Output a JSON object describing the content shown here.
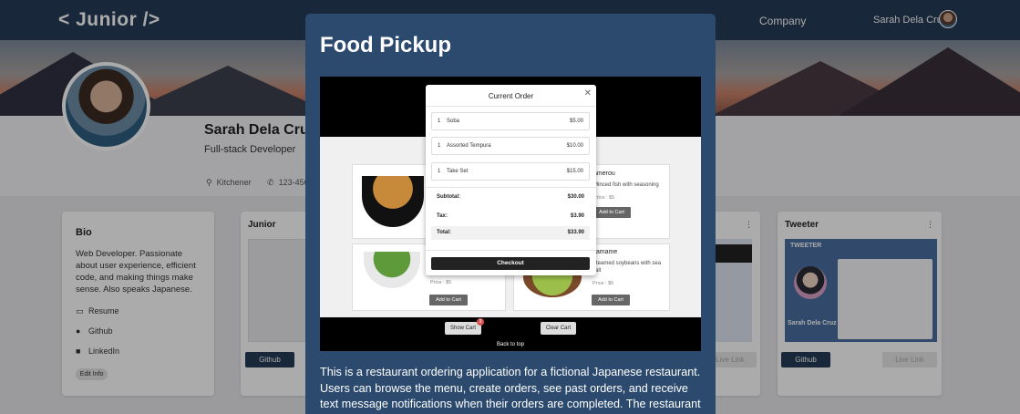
{
  "header": {
    "logo": "< Junior />",
    "nav_company": "Company",
    "user_name": "Sarah Dela Cruz"
  },
  "profile": {
    "name": "Sarah Dela Cruz",
    "title": "Full-stack Developer",
    "location": "Kitchener",
    "phone": "123-456"
  },
  "bio": {
    "heading": "Bio",
    "text": "Web Developer. Passionate about user experience, efficient code, and making things make sense. Also speaks Japanese.",
    "links": [
      "Resume",
      "Github",
      "LinkedIn"
    ],
    "edit_label": "Edit Info"
  },
  "projects": [
    {
      "title": "Junior",
      "github_label": "Github"
    },
    {
      "title": "",
      "github_label": "",
      "live_label": "Live Link"
    },
    {
      "title": "Tweeter",
      "github_label": "Github",
      "live_label": "Live Link",
      "thumb_brand": "TWEETER",
      "thumb_owner": "Sarah Dela Cruz"
    }
  ],
  "modal": {
    "title": "Food Pickup",
    "description": "This is a restaurant ordering application for a fictional Japanese restaurant. Users can browse the menu, create orders, see past orders, and receive text message notifications when their orders are completed. The restaurant can"
  },
  "app_shot": {
    "menu": [
      {
        "name": "amerou",
        "desc": "Minced fish with seasoning",
        "price": "Price : $5",
        "button": "Add to Cart"
      },
      {
        "name": "",
        "desc": "",
        "price": "Price : $5",
        "button": "Add to Cart"
      },
      {
        "name": "damame",
        "desc": "Steamed soybeans with sea salt",
        "price": "Price : $6",
        "button": "Add to Cart"
      }
    ],
    "show_cart": "Show Cart",
    "cart_count": "3",
    "clear_cart": "Clear Cart",
    "back_to_top": "Back to top",
    "order": {
      "title": "Current Order",
      "items": [
        {
          "qty": "1",
          "name": "Soba",
          "price": "$5.00"
        },
        {
          "qty": "1",
          "name": "Assorted Tempura",
          "price": "$10.00"
        },
        {
          "qty": "1",
          "name": "Take Set",
          "price": "$15.00"
        }
      ],
      "subtotal_label": "Subtotal:",
      "subtotal": "$30.00",
      "tax_label": "Tax:",
      "tax": "$3.90",
      "total_label": "Total:",
      "total": "$33.90",
      "checkout_label": "Checkout"
    }
  },
  "colors": {
    "navy": "#243b55",
    "modal_bg": "#2c4a6e",
    "button_dark": "#243b55"
  }
}
